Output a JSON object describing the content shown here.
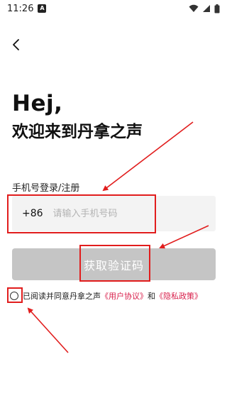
{
  "status_bar": {
    "time": "11:26",
    "app_icon_label": "A"
  },
  "header": {
    "back_icon": "chevron-left-icon"
  },
  "greeting": {
    "hello": "Hej,",
    "welcome": "欢迎来到丹拿之声"
  },
  "phone": {
    "label": "手机号登录/注册",
    "country_code": "+86",
    "placeholder": "请输入手机号码",
    "value": ""
  },
  "actions": {
    "get_code_label": "获取验证码"
  },
  "agreement": {
    "prefix": "已阅读并同意丹拿之声",
    "user_agreement": "《用户协议》",
    "conjunction": "和",
    "privacy_policy": "《隐私政策》",
    "checked": false
  },
  "colors": {
    "link": "#d81e4a",
    "button_disabled": "#c5c5c5",
    "annotation": "#e11d1d"
  }
}
